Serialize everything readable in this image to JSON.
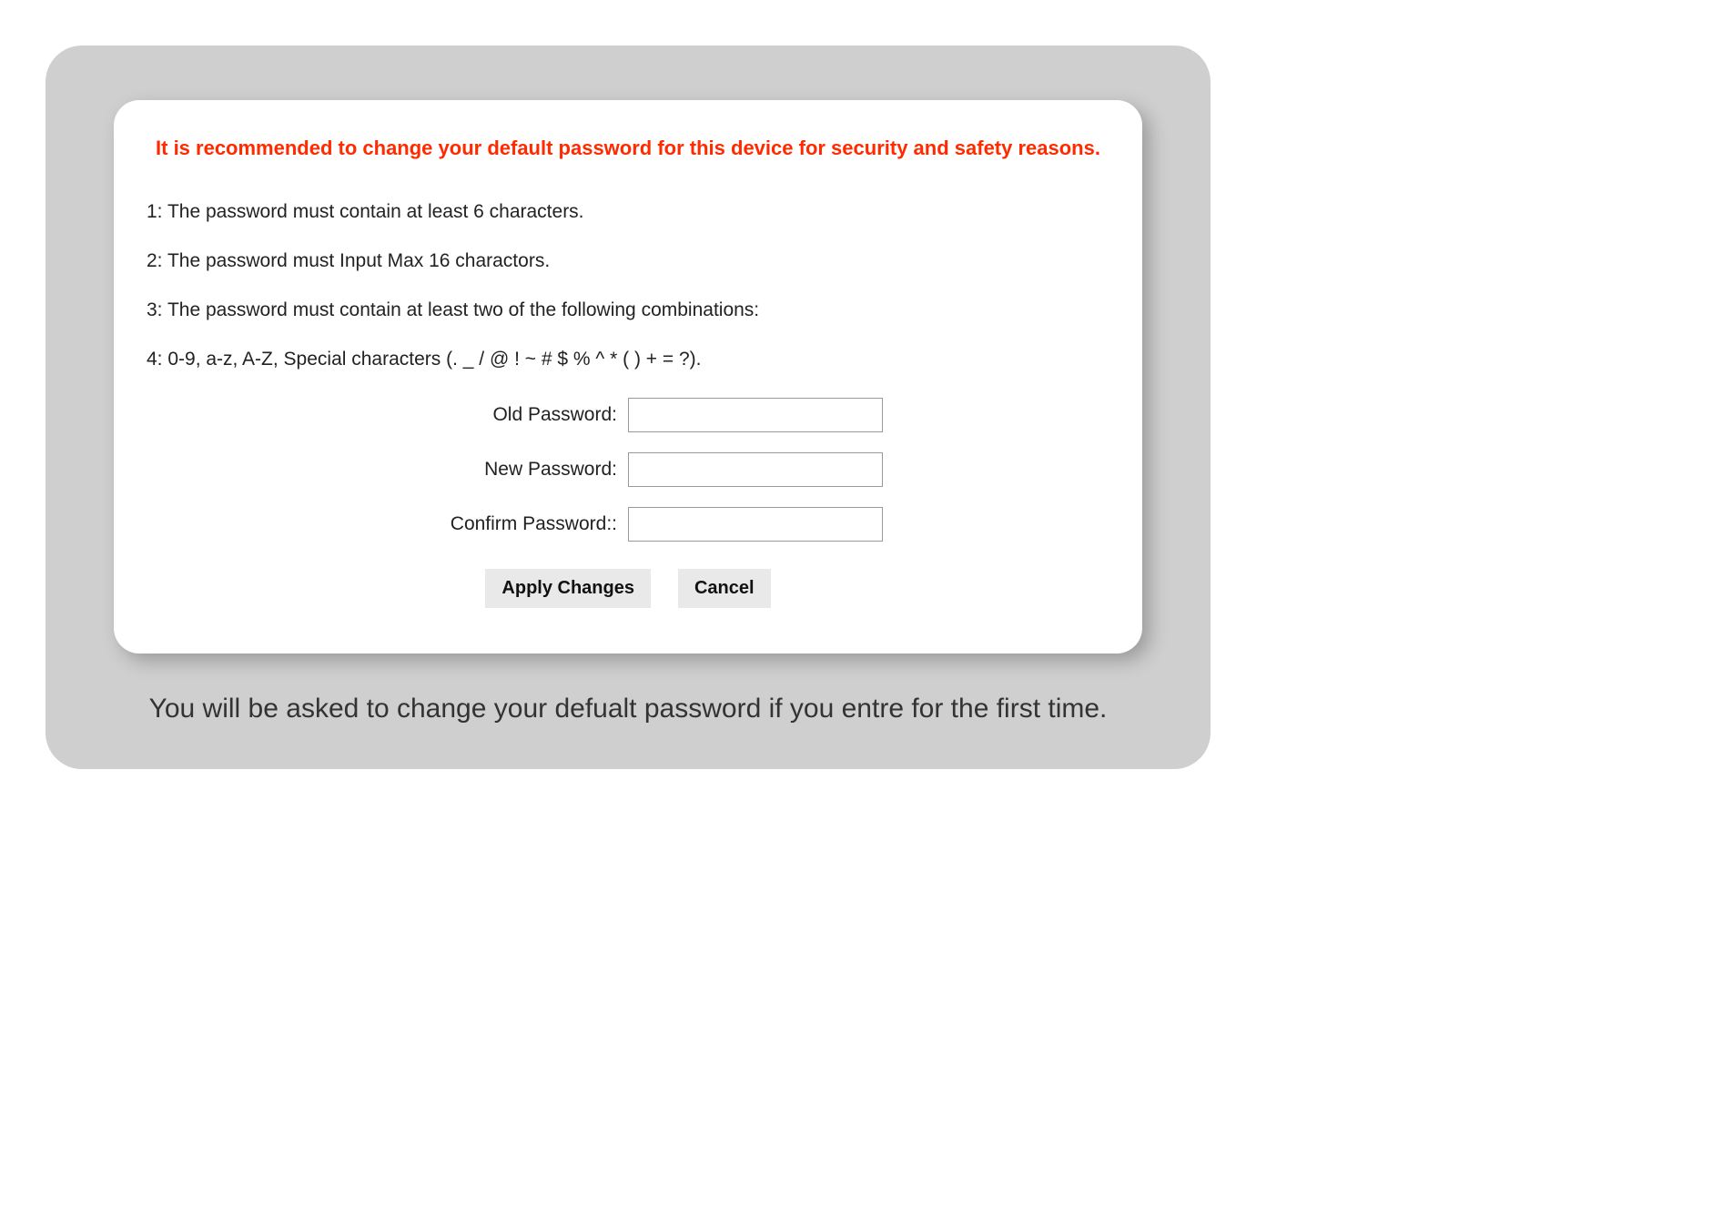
{
  "warning": "It is recommended to change your default password for this device for security and safety reasons.",
  "rules": {
    "r1": "1: The password must contain at least 6 characters.",
    "r2": "2: The password must Input Max 16 charactors.",
    "r3": "3: The password must contain at least two of the following combinations:",
    "r4": "4: 0-9, a-z, A-Z, Special characters (. _ / @ ! ~ # $ % ^ * ( ) + = ?)."
  },
  "form": {
    "old_password_label": "Old Password:",
    "new_password_label": "New Password:",
    "confirm_password_label": "Confirm Password::",
    "old_password_value": "",
    "new_password_value": "",
    "confirm_password_value": ""
  },
  "buttons": {
    "apply_label": "Apply Changes",
    "cancel_label": "Cancel"
  },
  "caption": "You will be asked to change your defualt password if you entre for the first time."
}
